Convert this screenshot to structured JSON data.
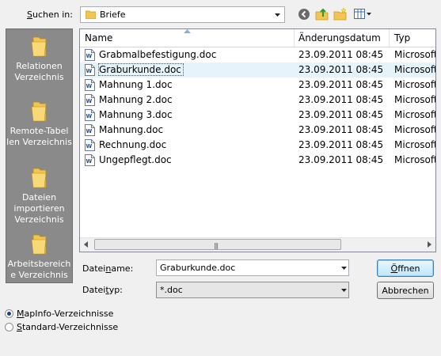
{
  "lookin": {
    "label_pre": "",
    "label_key": "S",
    "label_post": "uchen in:",
    "value": "Briefe"
  },
  "toolbar": {
    "back_icon": "back-icon",
    "up_icon": "up-folder-icon",
    "newfolder_icon": "new-folder-icon",
    "view_icon": "view-menu-icon"
  },
  "places": [
    {
      "label": "Relationen Verzeichnis"
    },
    {
      "label": "Remote-Tabel len Verzeichnis"
    },
    {
      "label": "Dateien importieren Verzeichnis"
    },
    {
      "label": "Arbeitsbereich e Verzeichnis"
    }
  ],
  "columns": {
    "name": "Name",
    "date": "Änderungsdatum",
    "type": "Typ"
  },
  "files": [
    {
      "name": "Grabmalbefestigung.doc",
      "date": "23.09.2011 08:45",
      "type": "Microsoft"
    },
    {
      "name": "Graburkunde.doc",
      "date": "23.09.2011 08:45",
      "type": "Microsoft"
    },
    {
      "name": "Mahnung 1.doc",
      "date": "23.09.2011 08:45",
      "type": "Microsoft"
    },
    {
      "name": "Mahnung 2.doc",
      "date": "23.09.2011 08:45",
      "type": "Microsoft"
    },
    {
      "name": "Mahnung 3.doc",
      "date": "23.09.2011 08:45",
      "type": "Microsoft"
    },
    {
      "name": "Mahnung.doc",
      "date": "23.09.2011 08:45",
      "type": "Microsoft"
    },
    {
      "name": "Rechnung.doc",
      "date": "23.09.2011 08:45",
      "type": "Microsoft"
    },
    {
      "name": "Ungepflegt.doc",
      "date": "23.09.2011 08:45",
      "type": "Microsoft"
    }
  ],
  "selected_index": 1,
  "filename": {
    "label_pre": "Datei",
    "label_key": "n",
    "label_post": "ame:",
    "value": "Graburkunde.doc"
  },
  "filetype": {
    "label_pre": "Datei",
    "label_key": "t",
    "label_post": "yp:",
    "value": "*.doc"
  },
  "buttons": {
    "open_key": "Ö",
    "open_rest": "ffnen",
    "cancel": "Abbrechen"
  },
  "radios": [
    {
      "label": "MapInfo-Verzeichnisse",
      "key": "M",
      "rest": "apInfo-Verzeichnisse",
      "checked": true
    },
    {
      "label": "Standard-Verzeichnisse",
      "key": "S",
      "rest": "tandard-Verzeichnisse",
      "checked": false
    }
  ],
  "colors": {
    "places_bg": "#8a8a8a",
    "selection": "#e5f3fb",
    "folder": "#f3c550"
  }
}
